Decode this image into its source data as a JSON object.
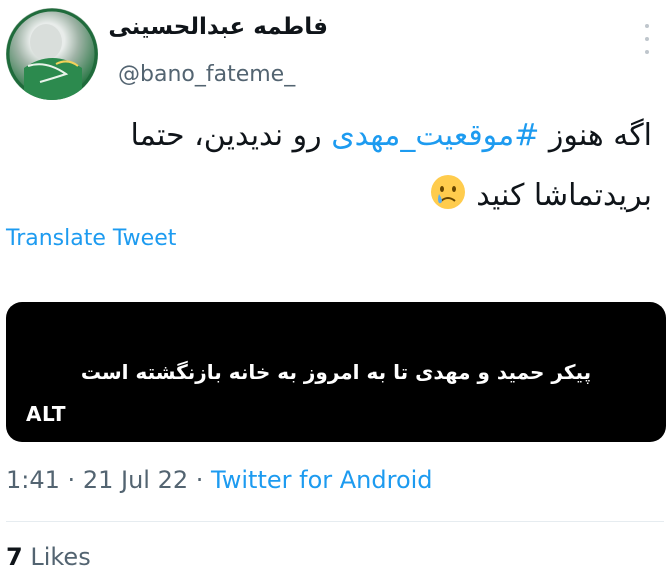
{
  "author": {
    "display_name": "فاطمه عبدالحسینی",
    "handle": "@bano_fateme_",
    "avatar_icon": "profile-avatar"
  },
  "tweet": {
    "text_before": "اگه هنوز ",
    "hashtag": "#موقعیت_مهدی",
    "text_after": " رو ندیدین، حتما بریدتماشا کنید"
  },
  "translate_label": "Translate Tweet",
  "media": {
    "caption": "پیکر حمید و مهدی تا به امروز به خانه بازنگشته است",
    "alt_label": "ALT"
  },
  "meta": {
    "time": "1:41",
    "separator": "·",
    "date": "21 Jul 22",
    "source": "Twitter for Android"
  },
  "likes": {
    "count": "7",
    "label": "Likes"
  },
  "colors": {
    "link": "#1d9bf0",
    "secondary_text": "#536471",
    "primary_text": "#0f1419"
  }
}
